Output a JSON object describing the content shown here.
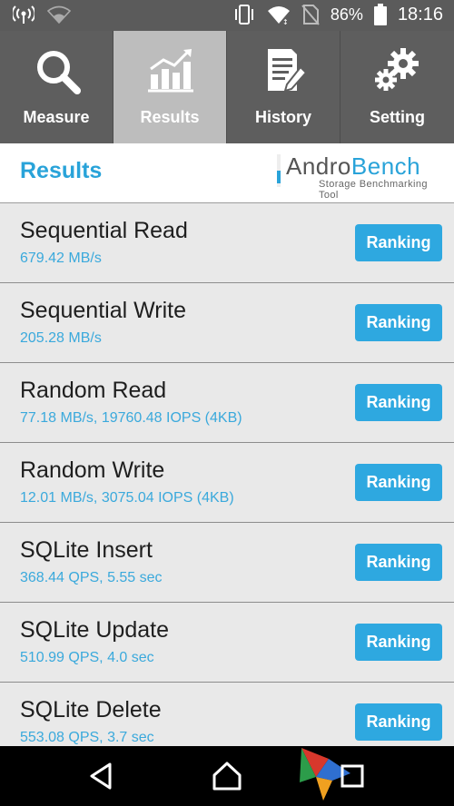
{
  "status_bar": {
    "battery_percent": "86%",
    "time": "18:16",
    "icons": [
      "hotspot-icon",
      "wifi-outline-icon",
      "vibrate-icon",
      "wifi-icon",
      "no-sim-icon",
      "battery-icon"
    ]
  },
  "tabs": [
    {
      "label": "Measure",
      "icon": "magnifier-icon",
      "active": false
    },
    {
      "label": "Results",
      "icon": "bar-chart-icon",
      "active": true
    },
    {
      "label": "History",
      "icon": "document-pencil-icon",
      "active": false
    },
    {
      "label": "Setting",
      "icon": "gears-icon",
      "active": false
    }
  ],
  "header": {
    "title": "Results",
    "logo": {
      "word1": "Andro",
      "word2": "Bench",
      "tagline": "Storage Benchmarking Tool"
    }
  },
  "results": [
    {
      "name": "Sequential Read",
      "value": "679.42 MB/s",
      "button": "Ranking"
    },
    {
      "name": "Sequential Write",
      "value": "205.28 MB/s",
      "button": "Ranking"
    },
    {
      "name": "Random Read",
      "value": "77.18 MB/s, 19760.48 IOPS (4KB)",
      "button": "Ranking"
    },
    {
      "name": "Random Write",
      "value": "12.01 MB/s, 3075.04 IOPS (4KB)",
      "button": "Ranking"
    },
    {
      "name": "SQLite Insert",
      "value": "368.44 QPS, 5.55 sec",
      "button": "Ranking"
    },
    {
      "name": "SQLite Update",
      "value": "510.99 QPS, 4.0 sec",
      "button": "Ranking"
    },
    {
      "name": "SQLite Delete",
      "value": "553.08 QPS, 3.7 sec",
      "button": "Ranking"
    }
  ],
  "colors": {
    "accent": "#2ea8e0",
    "tabbar": "#5e5e5e",
    "tab_active": "#bdbdbd",
    "list_bg": "#e9e9e9"
  }
}
